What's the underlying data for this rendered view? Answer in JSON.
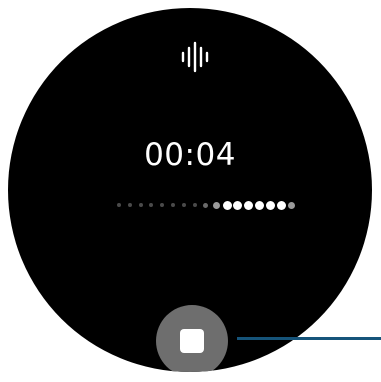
{
  "recorder": {
    "elapsed_time": "00:04",
    "icon": "voice-waveform-icon",
    "stop_button_icon": "stop-icon"
  },
  "level_meter": {
    "total_dots": 17,
    "active_from": 9,
    "colors": {
      "inactive": "#4a4a4a",
      "mid": "#9a9a9a",
      "active": "#ffffff"
    }
  },
  "colors": {
    "face_background": "#000000",
    "button_fill": "#6e6e6e",
    "callout_line": "#16547a"
  }
}
